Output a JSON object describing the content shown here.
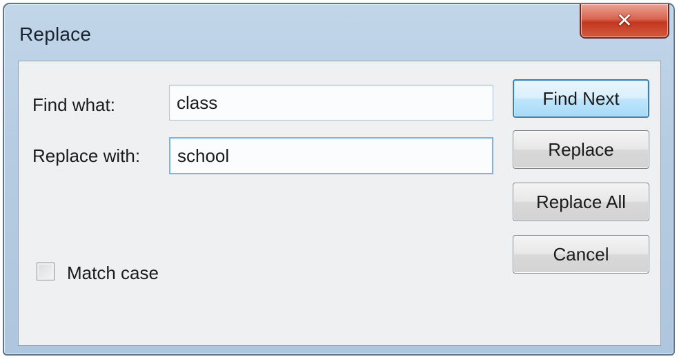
{
  "window": {
    "title": "Replace",
    "close_glyph": "✕"
  },
  "fields": {
    "find_label": "Find what:",
    "find_value": "class",
    "replace_label": "Replace with:",
    "replace_value": "school"
  },
  "buttons": {
    "find_next": "Find Next",
    "replace": "Replace",
    "replace_all": "Replace All",
    "cancel": "Cancel"
  },
  "options": {
    "match_case_label": "Match case",
    "match_case_checked": false
  },
  "icons": {
    "close": "close-icon"
  },
  "colors": {
    "titlebar": "#b6cce2",
    "close_button": "#d55a3d",
    "default_button_border": "#3c7fb1",
    "client_background": "#eef0f2"
  }
}
